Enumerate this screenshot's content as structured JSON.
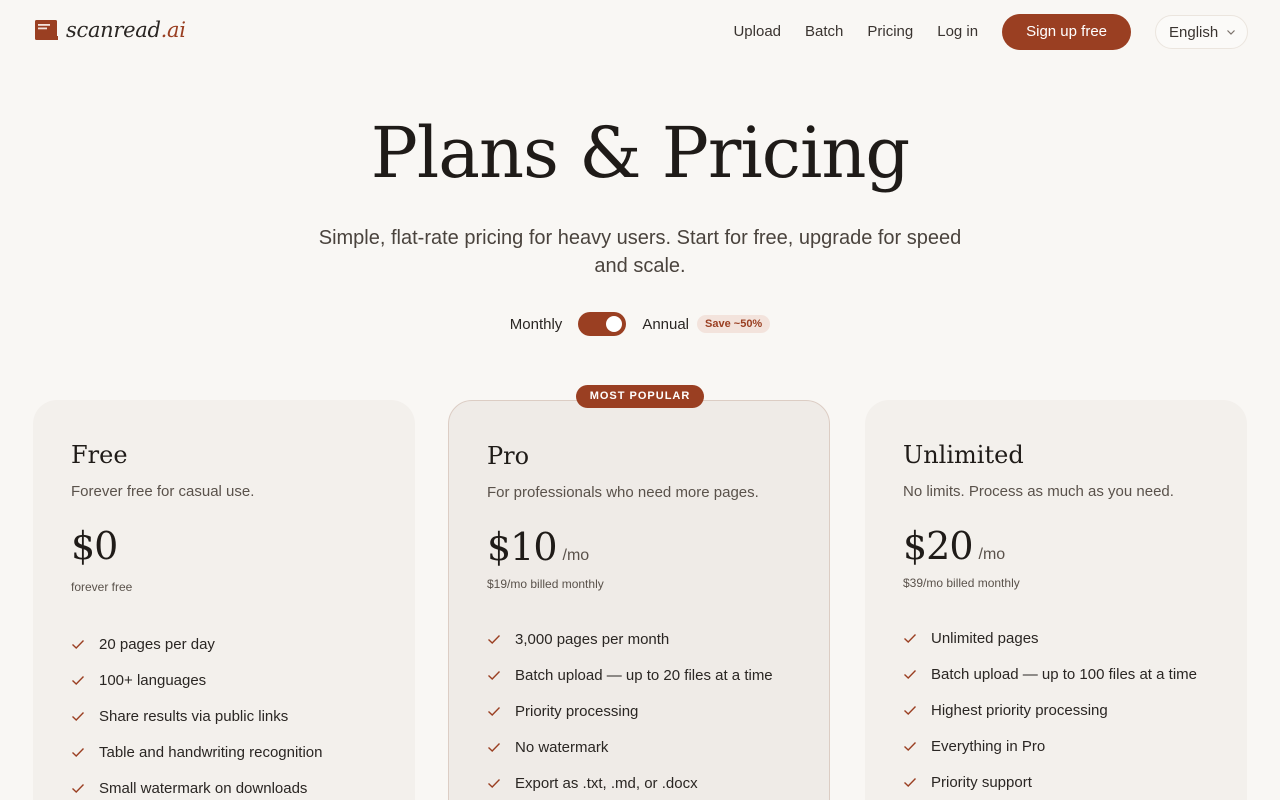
{
  "brand": {
    "name_main": "scanread",
    "name_accent": ".ai",
    "accent_color": "#9a3f22"
  },
  "nav": {
    "links": [
      "Upload",
      "Batch",
      "Pricing",
      "Log in"
    ],
    "signup_label": "Sign up free",
    "language": "English"
  },
  "hero": {
    "title": "Plans & Pricing",
    "subtitle": "Simple, flat-rate pricing for heavy users. Start for free, upgrade for speed and scale."
  },
  "billing": {
    "monthly_label": "Monthly",
    "annual_label": "Annual",
    "save_badge": "Save ~50%",
    "selected": "Annual"
  },
  "plans": [
    {
      "name": "Free",
      "description": "Forever free for casual use.",
      "price": "$0",
      "period": "",
      "billed_note": "forever free",
      "features": [
        "20 pages per day",
        "100+ languages",
        "Share results via public links",
        "Table and handwriting recognition",
        "Small watermark on downloads"
      ]
    },
    {
      "name": "Pro",
      "badge": "MOST POPULAR",
      "description": "For professionals who need more pages.",
      "price": "$10",
      "period": "/mo",
      "billed_note": "$19/mo billed monthly",
      "features": [
        "3,000 pages per month",
        "Batch upload — up to 20 files at a time",
        "Priority processing",
        "No watermark",
        "Export as .txt, .md, or .docx"
      ]
    },
    {
      "name": "Unlimited",
      "description": "No limits. Process as much as you need.",
      "price": "$20",
      "period": "/mo",
      "billed_note": "$39/mo billed monthly",
      "features": [
        "Unlimited pages",
        "Batch upload — up to 100 files at a time",
        "Highest priority processing",
        "Everything in Pro",
        "Priority support"
      ]
    }
  ],
  "icons": {
    "logo": "book-icon",
    "language_caret": "chevron-down-icon",
    "feature_bullet": "check-icon"
  }
}
